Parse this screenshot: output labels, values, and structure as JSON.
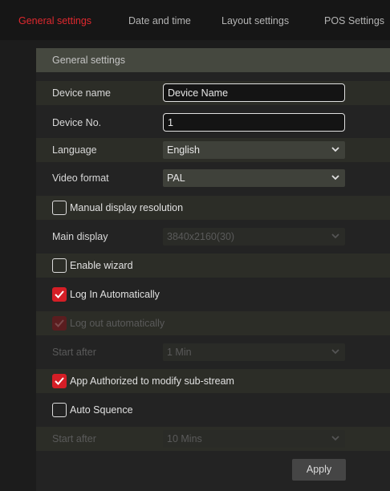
{
  "tabs": [
    {
      "label": "General settings",
      "active": true
    },
    {
      "label": "Date and time",
      "active": false
    },
    {
      "label": "Layout settings",
      "active": false
    },
    {
      "label": "POS Settings",
      "active": false
    }
  ],
  "section_title": "General settings",
  "fields": {
    "device_name": {
      "label": "Device name",
      "value": "Device Name"
    },
    "device_no": {
      "label": "Device No.",
      "value": "1"
    },
    "language": {
      "label": "Language",
      "value": "English"
    },
    "video_format": {
      "label": "Video format",
      "value": "PAL"
    },
    "manual_display_resolution": {
      "label": "Manual display resolution",
      "checked": false
    },
    "main_display": {
      "label": "Main display",
      "value": "3840x2160(30)",
      "disabled": true
    },
    "enable_wizard": {
      "label": "Enable wizard",
      "checked": false
    },
    "log_in_automatically": {
      "label": "Log In Automatically",
      "checked": true
    },
    "log_out_automatically": {
      "label": "Log out automatically",
      "checked": true,
      "disabled": true
    },
    "logout_start_after": {
      "label": "Start after",
      "value": "1 Min",
      "disabled": true
    },
    "app_authorized": {
      "label": "App Authorized to modify sub-stream",
      "checked": true
    },
    "auto_sequence": {
      "label": "Auto Squence",
      "checked": false
    },
    "sequence_start_after": {
      "label": "Start after",
      "value": "10 Mins",
      "disabled": true
    }
  },
  "buttons": {
    "apply": "Apply"
  },
  "colors": {
    "accent": "#d51e26",
    "background": "#1c1c1c",
    "header": "#45483f"
  }
}
